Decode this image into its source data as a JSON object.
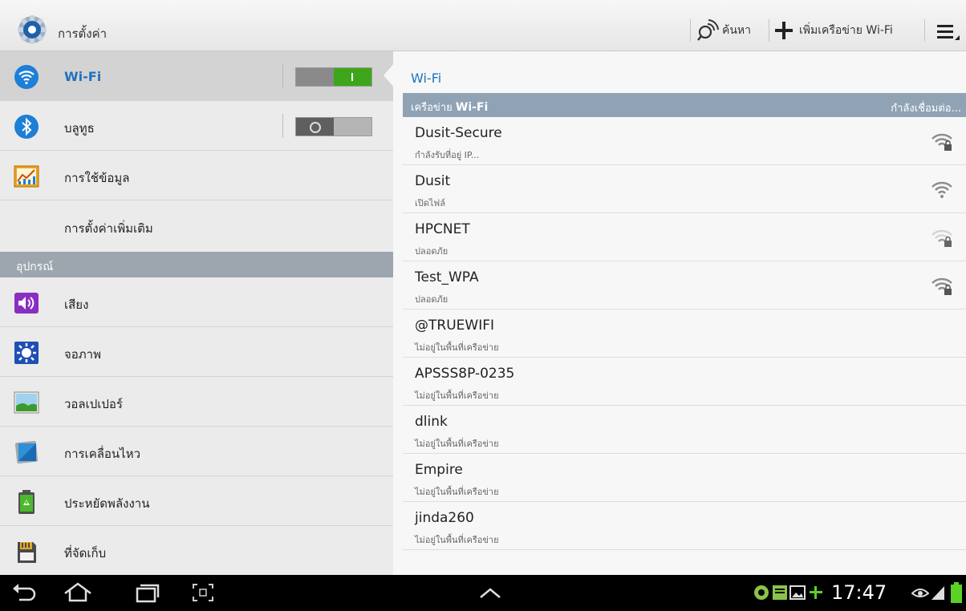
{
  "app": {
    "title": "การตั้งค่า",
    "icon": "settings-gear-icon"
  },
  "actions": {
    "search_label": "ค้นหา",
    "add_network_label": "เพิ่มเครือข่าย Wi-Fi",
    "search_icon": "search-icon",
    "add_icon": "plus-icon",
    "menu_icon": "overflow-menu-icon"
  },
  "sidebar": {
    "items": [
      {
        "label": "Wi-Fi",
        "icon": "wifi-icon",
        "toggle": "on",
        "selected": true
      },
      {
        "label": "บลูทูธ",
        "icon": "bluetooth-icon",
        "toggle": "off"
      },
      {
        "label": "การใช้ข้อมูล",
        "icon": "data-usage-icon"
      },
      {
        "label": "การตั้งค่าเพิ่มเติม"
      }
    ],
    "section_header": "อุปกรณ์",
    "device_items": [
      {
        "label": "เสียง",
        "icon": "sound-icon"
      },
      {
        "label": "จอภาพ",
        "icon": "display-icon"
      },
      {
        "label": "วอลเปเปอร์",
        "icon": "wallpaper-icon"
      },
      {
        "label": "การเคลื่อนไหว",
        "icon": "motion-icon"
      },
      {
        "label": "ประหยัดพลังงาน",
        "icon": "power-saving-icon"
      },
      {
        "label": "ที่จัดเก็บ",
        "icon": "storage-icon"
      }
    ]
  },
  "wifi_panel": {
    "title": "Wi-Fi",
    "header_left_prefix": "เครือข่าย",
    "header_left_bold": "Wi-Fi",
    "header_right": "กำลังเชื่อมต่อ...",
    "networks": [
      {
        "name": "Dusit-Secure",
        "status": "กำลังรับที่อยู่ IP...",
        "signal": "strong",
        "locked": true
      },
      {
        "name": "Dusit",
        "status": "เปิดไฟล์",
        "signal": "strong",
        "locked": false
      },
      {
        "name": "HPCNET",
        "status": "ปลอดภัย",
        "signal": "weak",
        "locked": true
      },
      {
        "name": "Test_WPA",
        "status": "ปลอดภัย",
        "signal": "strong",
        "locked": true
      },
      {
        "name": "@TRUEWIFI",
        "status": "ไม่อยู่ในพื้นที่เครือข่าย",
        "signal": "none"
      },
      {
        "name": "APSSS8P-0235",
        "status": "ไม่อยู่ในพื้นที่เครือข่าย",
        "signal": "none"
      },
      {
        "name": "dlink",
        "status": "ไม่อยู่ในพื้นที่เครือข่าย",
        "signal": "none"
      },
      {
        "name": "Empire",
        "status": "ไม่อยู่ในพื้นที่เครือข่าย",
        "signal": "none"
      },
      {
        "name": "jinda260",
        "status": "ไม่อยู่ในพื้นที่เครือข่าย",
        "signal": "none"
      }
    ]
  },
  "system_bar": {
    "clock": "17:47",
    "colors": {
      "battery": "#5cd126",
      "accent": "#1e73c0"
    }
  }
}
